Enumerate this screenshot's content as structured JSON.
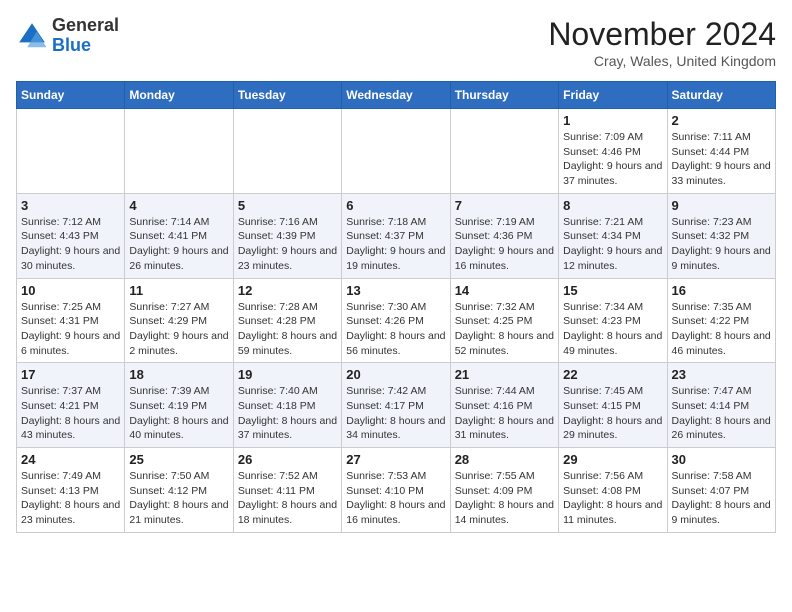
{
  "logo": {
    "general": "General",
    "blue": "Blue"
  },
  "title": "November 2024",
  "location": "Cray, Wales, United Kingdom",
  "days_header": [
    "Sunday",
    "Monday",
    "Tuesday",
    "Wednesday",
    "Thursday",
    "Friday",
    "Saturday"
  ],
  "weeks": [
    [
      null,
      null,
      null,
      null,
      null,
      {
        "day": "1",
        "sunrise": "Sunrise: 7:09 AM",
        "sunset": "Sunset: 4:46 PM",
        "daylight": "Daylight: 9 hours and 37 minutes."
      },
      {
        "day": "2",
        "sunrise": "Sunrise: 7:11 AM",
        "sunset": "Sunset: 4:44 PM",
        "daylight": "Daylight: 9 hours and 33 minutes."
      }
    ],
    [
      {
        "day": "3",
        "sunrise": "Sunrise: 7:12 AM",
        "sunset": "Sunset: 4:43 PM",
        "daylight": "Daylight: 9 hours and 30 minutes."
      },
      {
        "day": "4",
        "sunrise": "Sunrise: 7:14 AM",
        "sunset": "Sunset: 4:41 PM",
        "daylight": "Daylight: 9 hours and 26 minutes."
      },
      {
        "day": "5",
        "sunrise": "Sunrise: 7:16 AM",
        "sunset": "Sunset: 4:39 PM",
        "daylight": "Daylight: 9 hours and 23 minutes."
      },
      {
        "day": "6",
        "sunrise": "Sunrise: 7:18 AM",
        "sunset": "Sunset: 4:37 PM",
        "daylight": "Daylight: 9 hours and 19 minutes."
      },
      {
        "day": "7",
        "sunrise": "Sunrise: 7:19 AM",
        "sunset": "Sunset: 4:36 PM",
        "daylight": "Daylight: 9 hours and 16 minutes."
      },
      {
        "day": "8",
        "sunrise": "Sunrise: 7:21 AM",
        "sunset": "Sunset: 4:34 PM",
        "daylight": "Daylight: 9 hours and 12 minutes."
      },
      {
        "day": "9",
        "sunrise": "Sunrise: 7:23 AM",
        "sunset": "Sunset: 4:32 PM",
        "daylight": "Daylight: 9 hours and 9 minutes."
      }
    ],
    [
      {
        "day": "10",
        "sunrise": "Sunrise: 7:25 AM",
        "sunset": "Sunset: 4:31 PM",
        "daylight": "Daylight: 9 hours and 6 minutes."
      },
      {
        "day": "11",
        "sunrise": "Sunrise: 7:27 AM",
        "sunset": "Sunset: 4:29 PM",
        "daylight": "Daylight: 9 hours and 2 minutes."
      },
      {
        "day": "12",
        "sunrise": "Sunrise: 7:28 AM",
        "sunset": "Sunset: 4:28 PM",
        "daylight": "Daylight: 8 hours and 59 minutes."
      },
      {
        "day": "13",
        "sunrise": "Sunrise: 7:30 AM",
        "sunset": "Sunset: 4:26 PM",
        "daylight": "Daylight: 8 hours and 56 minutes."
      },
      {
        "day": "14",
        "sunrise": "Sunrise: 7:32 AM",
        "sunset": "Sunset: 4:25 PM",
        "daylight": "Daylight: 8 hours and 52 minutes."
      },
      {
        "day": "15",
        "sunrise": "Sunrise: 7:34 AM",
        "sunset": "Sunset: 4:23 PM",
        "daylight": "Daylight: 8 hours and 49 minutes."
      },
      {
        "day": "16",
        "sunrise": "Sunrise: 7:35 AM",
        "sunset": "Sunset: 4:22 PM",
        "daylight": "Daylight: 8 hours and 46 minutes."
      }
    ],
    [
      {
        "day": "17",
        "sunrise": "Sunrise: 7:37 AM",
        "sunset": "Sunset: 4:21 PM",
        "daylight": "Daylight: 8 hours and 43 minutes."
      },
      {
        "day": "18",
        "sunrise": "Sunrise: 7:39 AM",
        "sunset": "Sunset: 4:19 PM",
        "daylight": "Daylight: 8 hours and 40 minutes."
      },
      {
        "day": "19",
        "sunrise": "Sunrise: 7:40 AM",
        "sunset": "Sunset: 4:18 PM",
        "daylight": "Daylight: 8 hours and 37 minutes."
      },
      {
        "day": "20",
        "sunrise": "Sunrise: 7:42 AM",
        "sunset": "Sunset: 4:17 PM",
        "daylight": "Daylight: 8 hours and 34 minutes."
      },
      {
        "day": "21",
        "sunrise": "Sunrise: 7:44 AM",
        "sunset": "Sunset: 4:16 PM",
        "daylight": "Daylight: 8 hours and 31 minutes."
      },
      {
        "day": "22",
        "sunrise": "Sunrise: 7:45 AM",
        "sunset": "Sunset: 4:15 PM",
        "daylight": "Daylight: 8 hours and 29 minutes."
      },
      {
        "day": "23",
        "sunrise": "Sunrise: 7:47 AM",
        "sunset": "Sunset: 4:14 PM",
        "daylight": "Daylight: 8 hours and 26 minutes."
      }
    ],
    [
      {
        "day": "24",
        "sunrise": "Sunrise: 7:49 AM",
        "sunset": "Sunset: 4:13 PM",
        "daylight": "Daylight: 8 hours and 23 minutes."
      },
      {
        "day": "25",
        "sunrise": "Sunrise: 7:50 AM",
        "sunset": "Sunset: 4:12 PM",
        "daylight": "Daylight: 8 hours and 21 minutes."
      },
      {
        "day": "26",
        "sunrise": "Sunrise: 7:52 AM",
        "sunset": "Sunset: 4:11 PM",
        "daylight": "Daylight: 8 hours and 18 minutes."
      },
      {
        "day": "27",
        "sunrise": "Sunrise: 7:53 AM",
        "sunset": "Sunset: 4:10 PM",
        "daylight": "Daylight: 8 hours and 16 minutes."
      },
      {
        "day": "28",
        "sunrise": "Sunrise: 7:55 AM",
        "sunset": "Sunset: 4:09 PM",
        "daylight": "Daylight: 8 hours and 14 minutes."
      },
      {
        "day": "29",
        "sunrise": "Sunrise: 7:56 AM",
        "sunset": "Sunset: 4:08 PM",
        "daylight": "Daylight: 8 hours and 11 minutes."
      },
      {
        "day": "30",
        "sunrise": "Sunrise: 7:58 AM",
        "sunset": "Sunset: 4:07 PM",
        "daylight": "Daylight: 8 hours and 9 minutes."
      }
    ]
  ]
}
